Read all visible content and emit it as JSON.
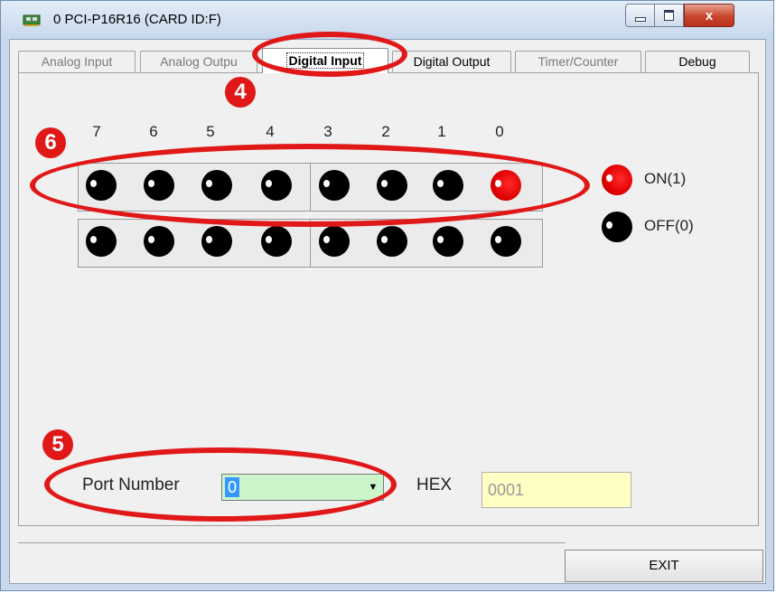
{
  "window": {
    "title": "0 PCI-P16R16 (CARD ID:F)",
    "icon": "card-icon",
    "buttons": {
      "minimize": "minimize-icon",
      "maximize": "maximize-icon",
      "close": "x"
    }
  },
  "tabs": [
    {
      "label": "Analog Input"
    },
    {
      "label": "Analog Outpu"
    },
    {
      "label": "Digital Input",
      "active": true
    },
    {
      "label": "Digital Output"
    },
    {
      "label": "Timer/Counter"
    },
    {
      "label": "Debug"
    }
  ],
  "bits": [
    "7",
    "6",
    "5",
    "4",
    "3",
    "2",
    "1",
    "0"
  ],
  "leds": {
    "row1": [
      0,
      0,
      0,
      0,
      0,
      0,
      0,
      1
    ],
    "row2": [
      0,
      0,
      0,
      0,
      0,
      0,
      0,
      0
    ]
  },
  "legend": {
    "on": "ON(1)",
    "off": "OFF(0)"
  },
  "port": {
    "label": "Port Number",
    "value": "0"
  },
  "hex": {
    "label": "HEX",
    "value": "0001"
  },
  "exit_label": "EXIT",
  "annotations": [
    "4",
    "5",
    "6"
  ],
  "colors": {
    "led_on": "#e00000",
    "led_off": "#000000",
    "annotation": "#e01818",
    "combo_bg": "#ccf5cc",
    "hex_bg": "#ffffc4"
  }
}
